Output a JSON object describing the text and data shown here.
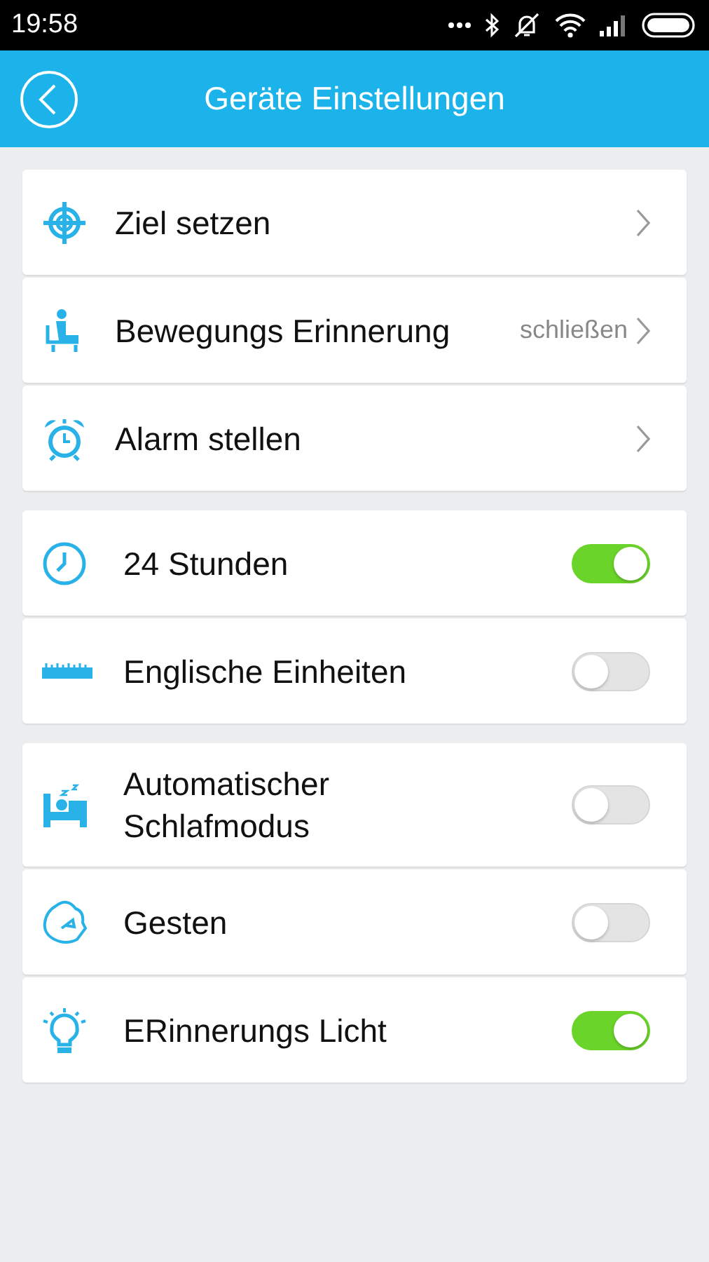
{
  "status_bar": {
    "time": "19:58"
  },
  "header": {
    "title": "Geräte Einstellungen"
  },
  "groups": [
    {
      "rows": [
        {
          "kind": "link",
          "label": "Ziel setzen"
        },
        {
          "kind": "link",
          "label": "Bewegungs Erinnerung",
          "value": "schließen"
        },
        {
          "kind": "link",
          "label": "Alarm stellen"
        }
      ]
    },
    {
      "rows": [
        {
          "kind": "toggle",
          "label": "24 Stunden",
          "on": true
        },
        {
          "kind": "toggle",
          "label": "Englische Einheiten",
          "on": false
        }
      ]
    },
    {
      "rows": [
        {
          "kind": "toggle",
          "label": "Automatischer Schlafmodus",
          "on": false
        },
        {
          "kind": "toggle",
          "label": "Gesten",
          "on": false
        },
        {
          "kind": "toggle",
          "label": "ERinnerungs Licht",
          "on": true
        }
      ]
    }
  ]
}
